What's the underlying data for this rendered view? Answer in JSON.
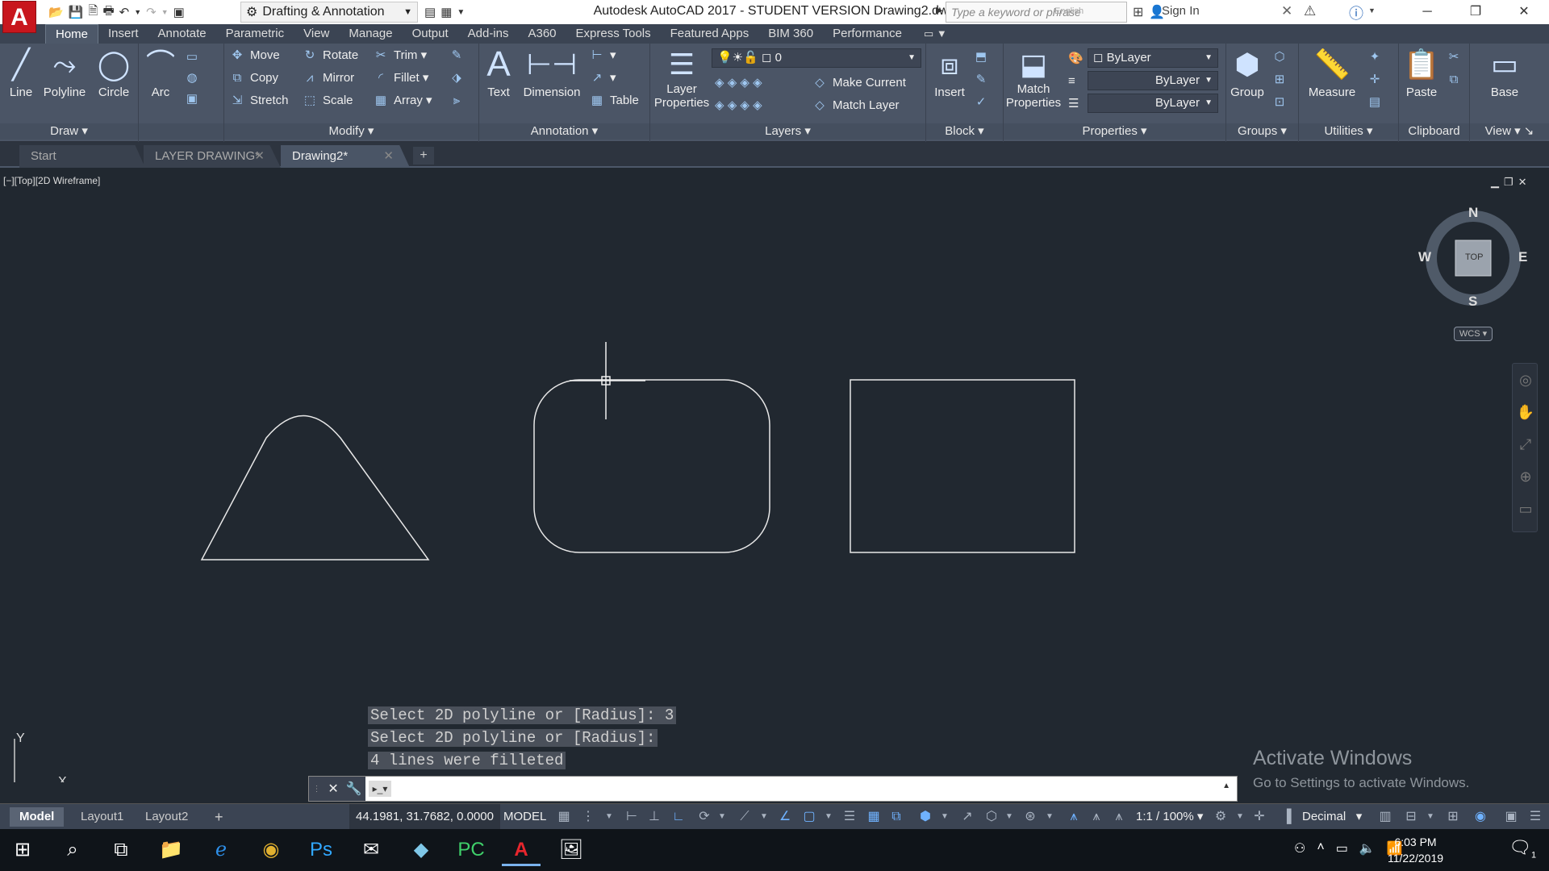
{
  "titlebar": {
    "app_letter": "A",
    "workspace": "Drafting & Annotation",
    "title": "Autodesk AutoCAD 2017 - STUDENT VERSION    Drawing2.dwg",
    "search_placeholder": "Type a keyword or phrase",
    "sign_in": "Sign In",
    "search_overlay": "English"
  },
  "ribbon_tabs": [
    "Home",
    "Insert",
    "Annotate",
    "Parametric",
    "View",
    "Manage",
    "Output",
    "Add-ins",
    "A360",
    "Express Tools",
    "Featured Apps",
    "BIM 360",
    "Performance"
  ],
  "ribbon": {
    "draw": {
      "line": "Line",
      "polyline": "Polyline",
      "circle": "Circle",
      "arc": "Arc",
      "label": "Draw"
    },
    "modify": {
      "move": "Move",
      "rotate": "Rotate",
      "trim": "Trim",
      "copy": "Copy",
      "mirror": "Mirror",
      "fillet": "Fillet",
      "stretch": "Stretch",
      "scale": "Scale",
      "array": "Array",
      "label": "Modify"
    },
    "annotation": {
      "text": "Text",
      "dimension": "Dimension",
      "table": "Table",
      "label": "Annotation"
    },
    "layers": {
      "layer_properties_1": "Layer",
      "layer_properties_2": "Properties",
      "current_layer": "0",
      "make_current": "Make Current",
      "match_layer": "Match Layer",
      "label": "Layers"
    },
    "block": {
      "insert": "Insert",
      "label": "Block"
    },
    "properties": {
      "match_1": "Match",
      "match_2": "Properties",
      "color": "ByLayer",
      "lineweight": "ByLayer",
      "linetype": "ByLayer",
      "label": "Properties"
    },
    "groups": {
      "group": "Group",
      "label": "Groups"
    },
    "utilities": {
      "measure": "Measure",
      "label": "Utilities"
    },
    "clipboard": {
      "paste": "Paste",
      "label": "Clipboard"
    },
    "view": {
      "base": "Base",
      "label": "View"
    }
  },
  "doc_tabs": [
    {
      "label": "Start"
    },
    {
      "label": "LAYER DRAWING*"
    },
    {
      "label": "Drawing2*"
    }
  ],
  "viewport": {
    "label": "[−][Top][2D Wireframe]",
    "viewcube": {
      "top": "TOP",
      "n": "N",
      "s": "S",
      "e": "E",
      "w": "W",
      "wcs": "WCS"
    },
    "ucs": {
      "x": "X",
      "y": "Y"
    }
  },
  "command": {
    "history": [
      "Select 2D polyline or [Radius]: 3",
      "Select 2D polyline or [Radius]:",
      "4 lines were filleted"
    ],
    "input_value": ""
  },
  "activate": {
    "title": "Activate Windows",
    "subtitle": "Go to Settings to activate Windows."
  },
  "statusbar": {
    "layouts": [
      "Model",
      "Layout1",
      "Layout2"
    ],
    "coords": "44.1981, 31.7682, 0.0000",
    "model": "MODEL",
    "scale": "1:1 / 100%",
    "units": "Decimal"
  },
  "taskbar": {
    "time": "6:03 PM",
    "date": "11/22/2019",
    "notif_count": "1"
  }
}
